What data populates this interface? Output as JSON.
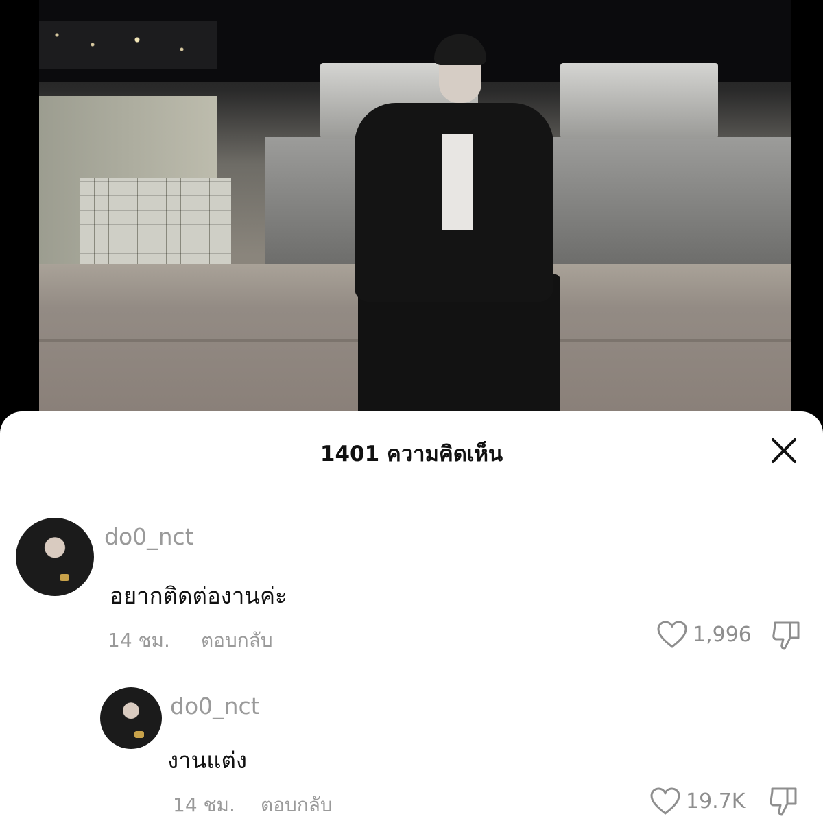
{
  "sheet": {
    "title": "1401 ความคิดเห็น"
  },
  "comments": [
    {
      "username": "do0_nct",
      "text": "อยากติดต่องานค่ะ",
      "time": "14 ชม.",
      "reply_label": "ตอบกลับ",
      "likes": "1,996"
    },
    {
      "username": "do0_nct",
      "text": "งานแต่ง",
      "time": "14 ชม.",
      "reply_label": "ตอบกลับ",
      "likes": "19.7K"
    }
  ],
  "icons": {
    "close": "close-icon",
    "like": "heart-icon",
    "dislike": "thumbs-down-icon"
  }
}
